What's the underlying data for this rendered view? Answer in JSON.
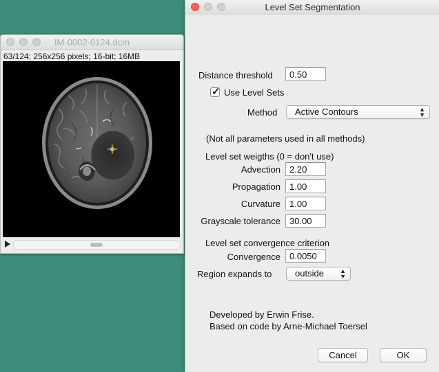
{
  "image_window": {
    "title": "IM-0002-0124.dcm",
    "info": "63/124; 256x256 pixels; 16-bit; 16MB"
  },
  "dialog": {
    "title": "Level Set Segmentation",
    "distance_threshold": {
      "label": "Distance threshold",
      "value": "0.50"
    },
    "use_level_sets": {
      "label": "Use Level Sets",
      "checked": true
    },
    "method": {
      "label": "Method",
      "value": "Active Contours"
    },
    "note": "(Not all parameters used in all methods)",
    "weights_heading": "Level set weigths (0 = don't use)",
    "advection": {
      "label": "Advection",
      "value": "2.20"
    },
    "propagation": {
      "label": "Propagation",
      "value": "1.00"
    },
    "curvature": {
      "label": "Curvature",
      "value": "1.00"
    },
    "grayscale_tolerance": {
      "label": "Grayscale tolerance",
      "value": "30.00"
    },
    "convergence_heading": "Level set convergence criterion",
    "convergence": {
      "label": "Convergence",
      "value": "0.0050"
    },
    "region_expands": {
      "label": "Region expands to",
      "value": "outside"
    },
    "credits": [
      "Developed by Erwin Frise.",
      "Based on code by Arne-Michael Toersel"
    ],
    "cancel_label": "Cancel",
    "ok_label": "OK"
  },
  "colors": {
    "desktop": "#3f8b7a",
    "window_bg": "#ececec",
    "close": "#fc5f57",
    "minimize": "#fdbc2e",
    "zoom": "#28c840"
  }
}
